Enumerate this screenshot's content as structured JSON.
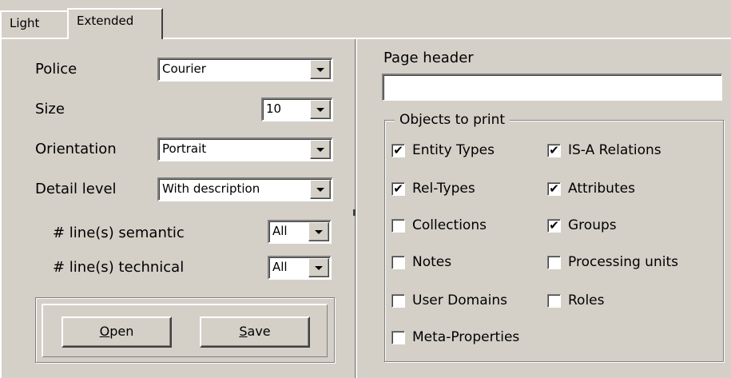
{
  "tabs": {
    "light": "Light",
    "extended": "Extended"
  },
  "fields": {
    "police": {
      "label": "Police",
      "value": "Courier"
    },
    "size": {
      "label": "Size",
      "value": "10"
    },
    "orientation": {
      "label": "Orientation",
      "value": "Portrait"
    },
    "detail": {
      "label": "Detail level",
      "value": "With description"
    },
    "semantic": {
      "label": "# line(s) semantic",
      "value": "All"
    },
    "technical": {
      "label": "# line(s) technical",
      "value": "All"
    }
  },
  "buttons": {
    "open": {
      "accel": "O",
      "rest": "pen"
    },
    "save": {
      "accel": "S",
      "rest": "ave"
    }
  },
  "page_header": {
    "label": "Page header",
    "value": ""
  },
  "objects": {
    "legend": "Objects to print",
    "items": [
      {
        "label": "Entity Types",
        "checked": true
      },
      {
        "label": "IS-A Relations",
        "checked": true
      },
      {
        "label": "Rel-Types",
        "checked": true
      },
      {
        "label": "Attributes",
        "checked": true
      },
      {
        "label": "Collections",
        "checked": false
      },
      {
        "label": "Groups",
        "checked": true
      },
      {
        "label": "Notes",
        "checked": false
      },
      {
        "label": "Processing units",
        "checked": false
      },
      {
        "label": "User Domains",
        "checked": false
      },
      {
        "label": "Roles",
        "checked": false
      },
      {
        "label": "Meta-Properties",
        "checked": false
      }
    ]
  },
  "colors": {
    "face": "#d4d0c8",
    "shadow": "#808080",
    "highlight": "#ffffff"
  }
}
